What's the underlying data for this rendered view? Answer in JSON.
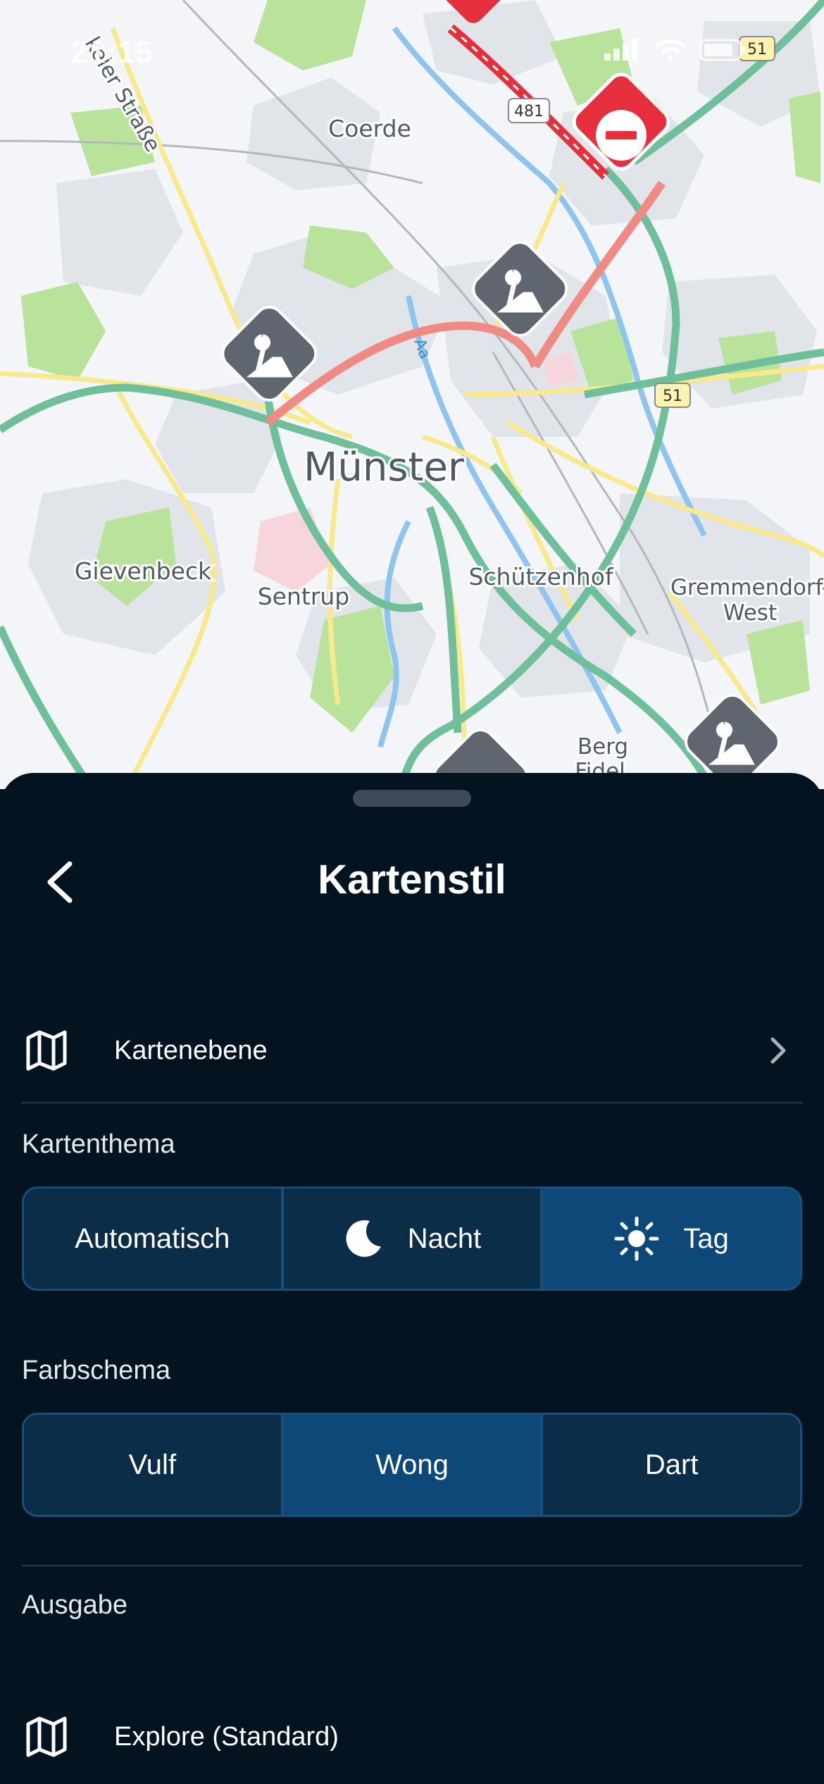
{
  "status_bar": {
    "time": "21:15"
  },
  "map": {
    "city_label": "Münster",
    "district_labels": [
      "Coerde",
      "Gievenbeck",
      "Sentrup",
      "Schützenhof",
      "Gremmendorf-",
      "West",
      "Berg",
      "Fidel",
      "Aa"
    ],
    "street_label": "keler Straße",
    "shields": [
      "481",
      "51",
      "51"
    ]
  },
  "sheet": {
    "title": "Kartenstil",
    "layer_row_label": "Kartenebene",
    "theme_section_label": "Kartenthema",
    "theme_options": [
      "Automatisch",
      "Nacht",
      "Tag"
    ],
    "theme_selected": "Tag",
    "color_section_label": "Farbschema",
    "color_options": [
      "Vulf",
      "Wong",
      "Dart"
    ],
    "color_selected": "Wong",
    "output_section_label": "Ausgabe",
    "output_row_label": "Explore (Standard)"
  },
  "colors": {
    "sheet_bg": "#03131f",
    "segment_bg": "#0c2d48",
    "segment_active": "#0e4878",
    "segment_border": "#17507c",
    "map_green_road": "#6fbf9a",
    "map_red_road": "#f08a84",
    "map_yellow_road": "#f8e98c",
    "closure_red": "#e52f3d",
    "construction_marker": "#5f6670"
  },
  "icons": {
    "back": "chevron-left-icon",
    "layer": "map-icon",
    "row_chevron": "chevron-right-icon",
    "night": "moon-icon",
    "day": "sun-icon",
    "output": "map-icon",
    "closure": "no-entry-icon",
    "construction": "road-works-icon"
  }
}
